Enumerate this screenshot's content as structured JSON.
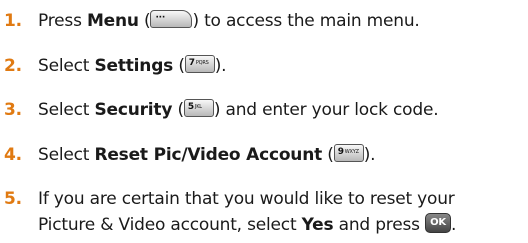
{
  "steps": [
    {
      "number": "1.",
      "before": "Press ",
      "bold": "Menu",
      "paren_open": " (",
      "paren_close": ")",
      "after": " to access the main menu.",
      "key": {
        "icon": "menu-softkey-icon",
        "glyph": "···"
      }
    },
    {
      "number": "2.",
      "before": "Select ",
      "bold": "Settings",
      "paren_open": " (",
      "paren_close": ").",
      "after": "",
      "key": {
        "icon": "key-7-icon",
        "digit": "7",
        "letters": "PQRS"
      }
    },
    {
      "number": "3.",
      "before": "Select ",
      "bold": "Security",
      "paren_open": " (",
      "paren_close": ")",
      "after": " and enter your lock code.",
      "key": {
        "icon": "key-5-icon",
        "digit": "5",
        "letters": "JKL"
      }
    },
    {
      "number": "4.",
      "before": "Select ",
      "bold": "Reset Pic/Video Account",
      "paren_open": " (",
      "paren_close": ").",
      "after": "",
      "key": {
        "icon": "key-9-icon",
        "digit": "9",
        "letters": "WXYZ"
      }
    },
    {
      "number": "5.",
      "line1": "If you are certain that you would like to reset your",
      "line2_before": "Picture & Video account, select ",
      "line2_bold": "Yes",
      "line2_mid": " and press ",
      "line2_after": ".",
      "key": {
        "icon": "ok-key-icon",
        "label": "OK"
      }
    }
  ],
  "colors": {
    "step_number": "#e07a12",
    "text": "#1a1a1a"
  }
}
